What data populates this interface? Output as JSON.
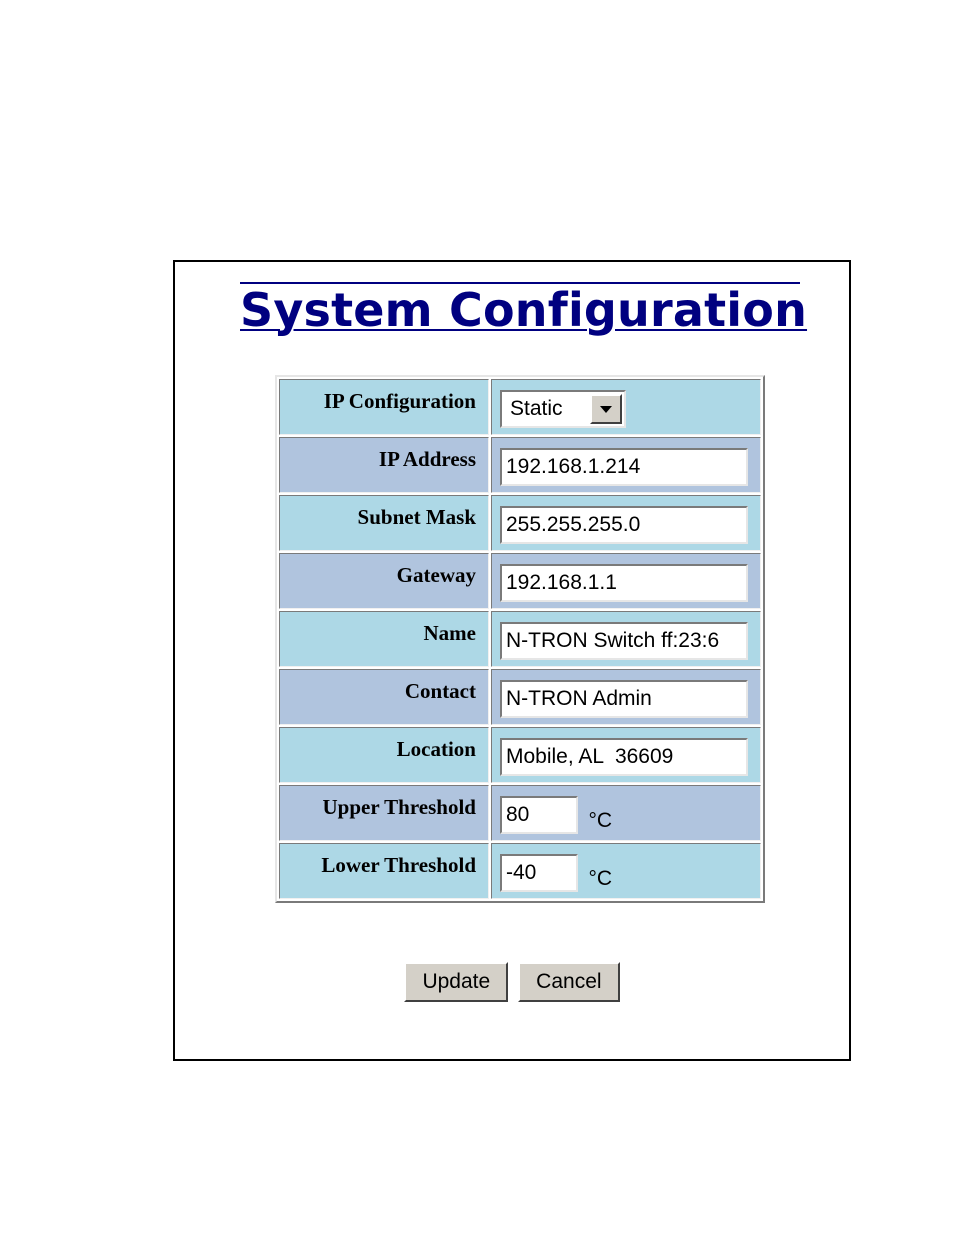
{
  "page": {
    "title": "System Configuration"
  },
  "form": {
    "ip_configuration": {
      "label": "IP Configuration",
      "selected": "Static"
    },
    "ip_address": {
      "label": "IP Address",
      "value": "192.168.1.214"
    },
    "subnet_mask": {
      "label": "Subnet Mask",
      "value": "255.255.255.0"
    },
    "gateway": {
      "label": "Gateway",
      "value": "192.168.1.1"
    },
    "name": {
      "label": "Name",
      "value": "N-TRON Switch ff:23:6"
    },
    "contact": {
      "label": "Contact",
      "value": "N-TRON Admin"
    },
    "location": {
      "label": "Location",
      "value": "Mobile, AL  36609"
    },
    "upper_threshold": {
      "label": "Upper Threshold",
      "value": "80",
      "unit": "°C"
    },
    "lower_threshold": {
      "label": "Lower Threshold",
      "value": "-40",
      "unit": "°C"
    }
  },
  "buttons": {
    "update_label": "Update",
    "cancel_label": "Cancel"
  },
  "colors": {
    "title": "#000080",
    "row_light": "#add8e6",
    "row_dark": "#b0c4de",
    "button_face": "#d4d0c8"
  },
  "icons": {
    "select_arrow": "chevron-down-icon"
  }
}
